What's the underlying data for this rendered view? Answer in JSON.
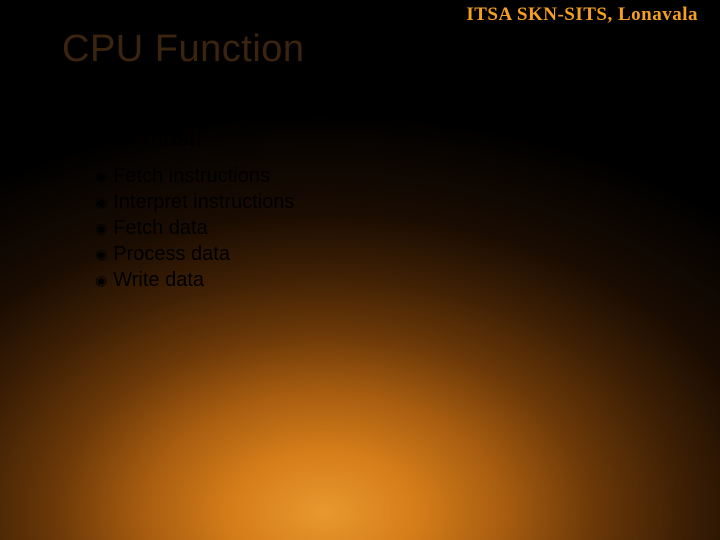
{
  "header": {
    "org": "ITSA SKN-SITS, Lonavala"
  },
  "slide": {
    "title": "CPU Function",
    "bullet_l1": "CPU must:",
    "sub_items": [
      "Fetch instructions",
      "Interpret instructions",
      "Fetch data",
      "Process data",
      "Write data"
    ]
  }
}
